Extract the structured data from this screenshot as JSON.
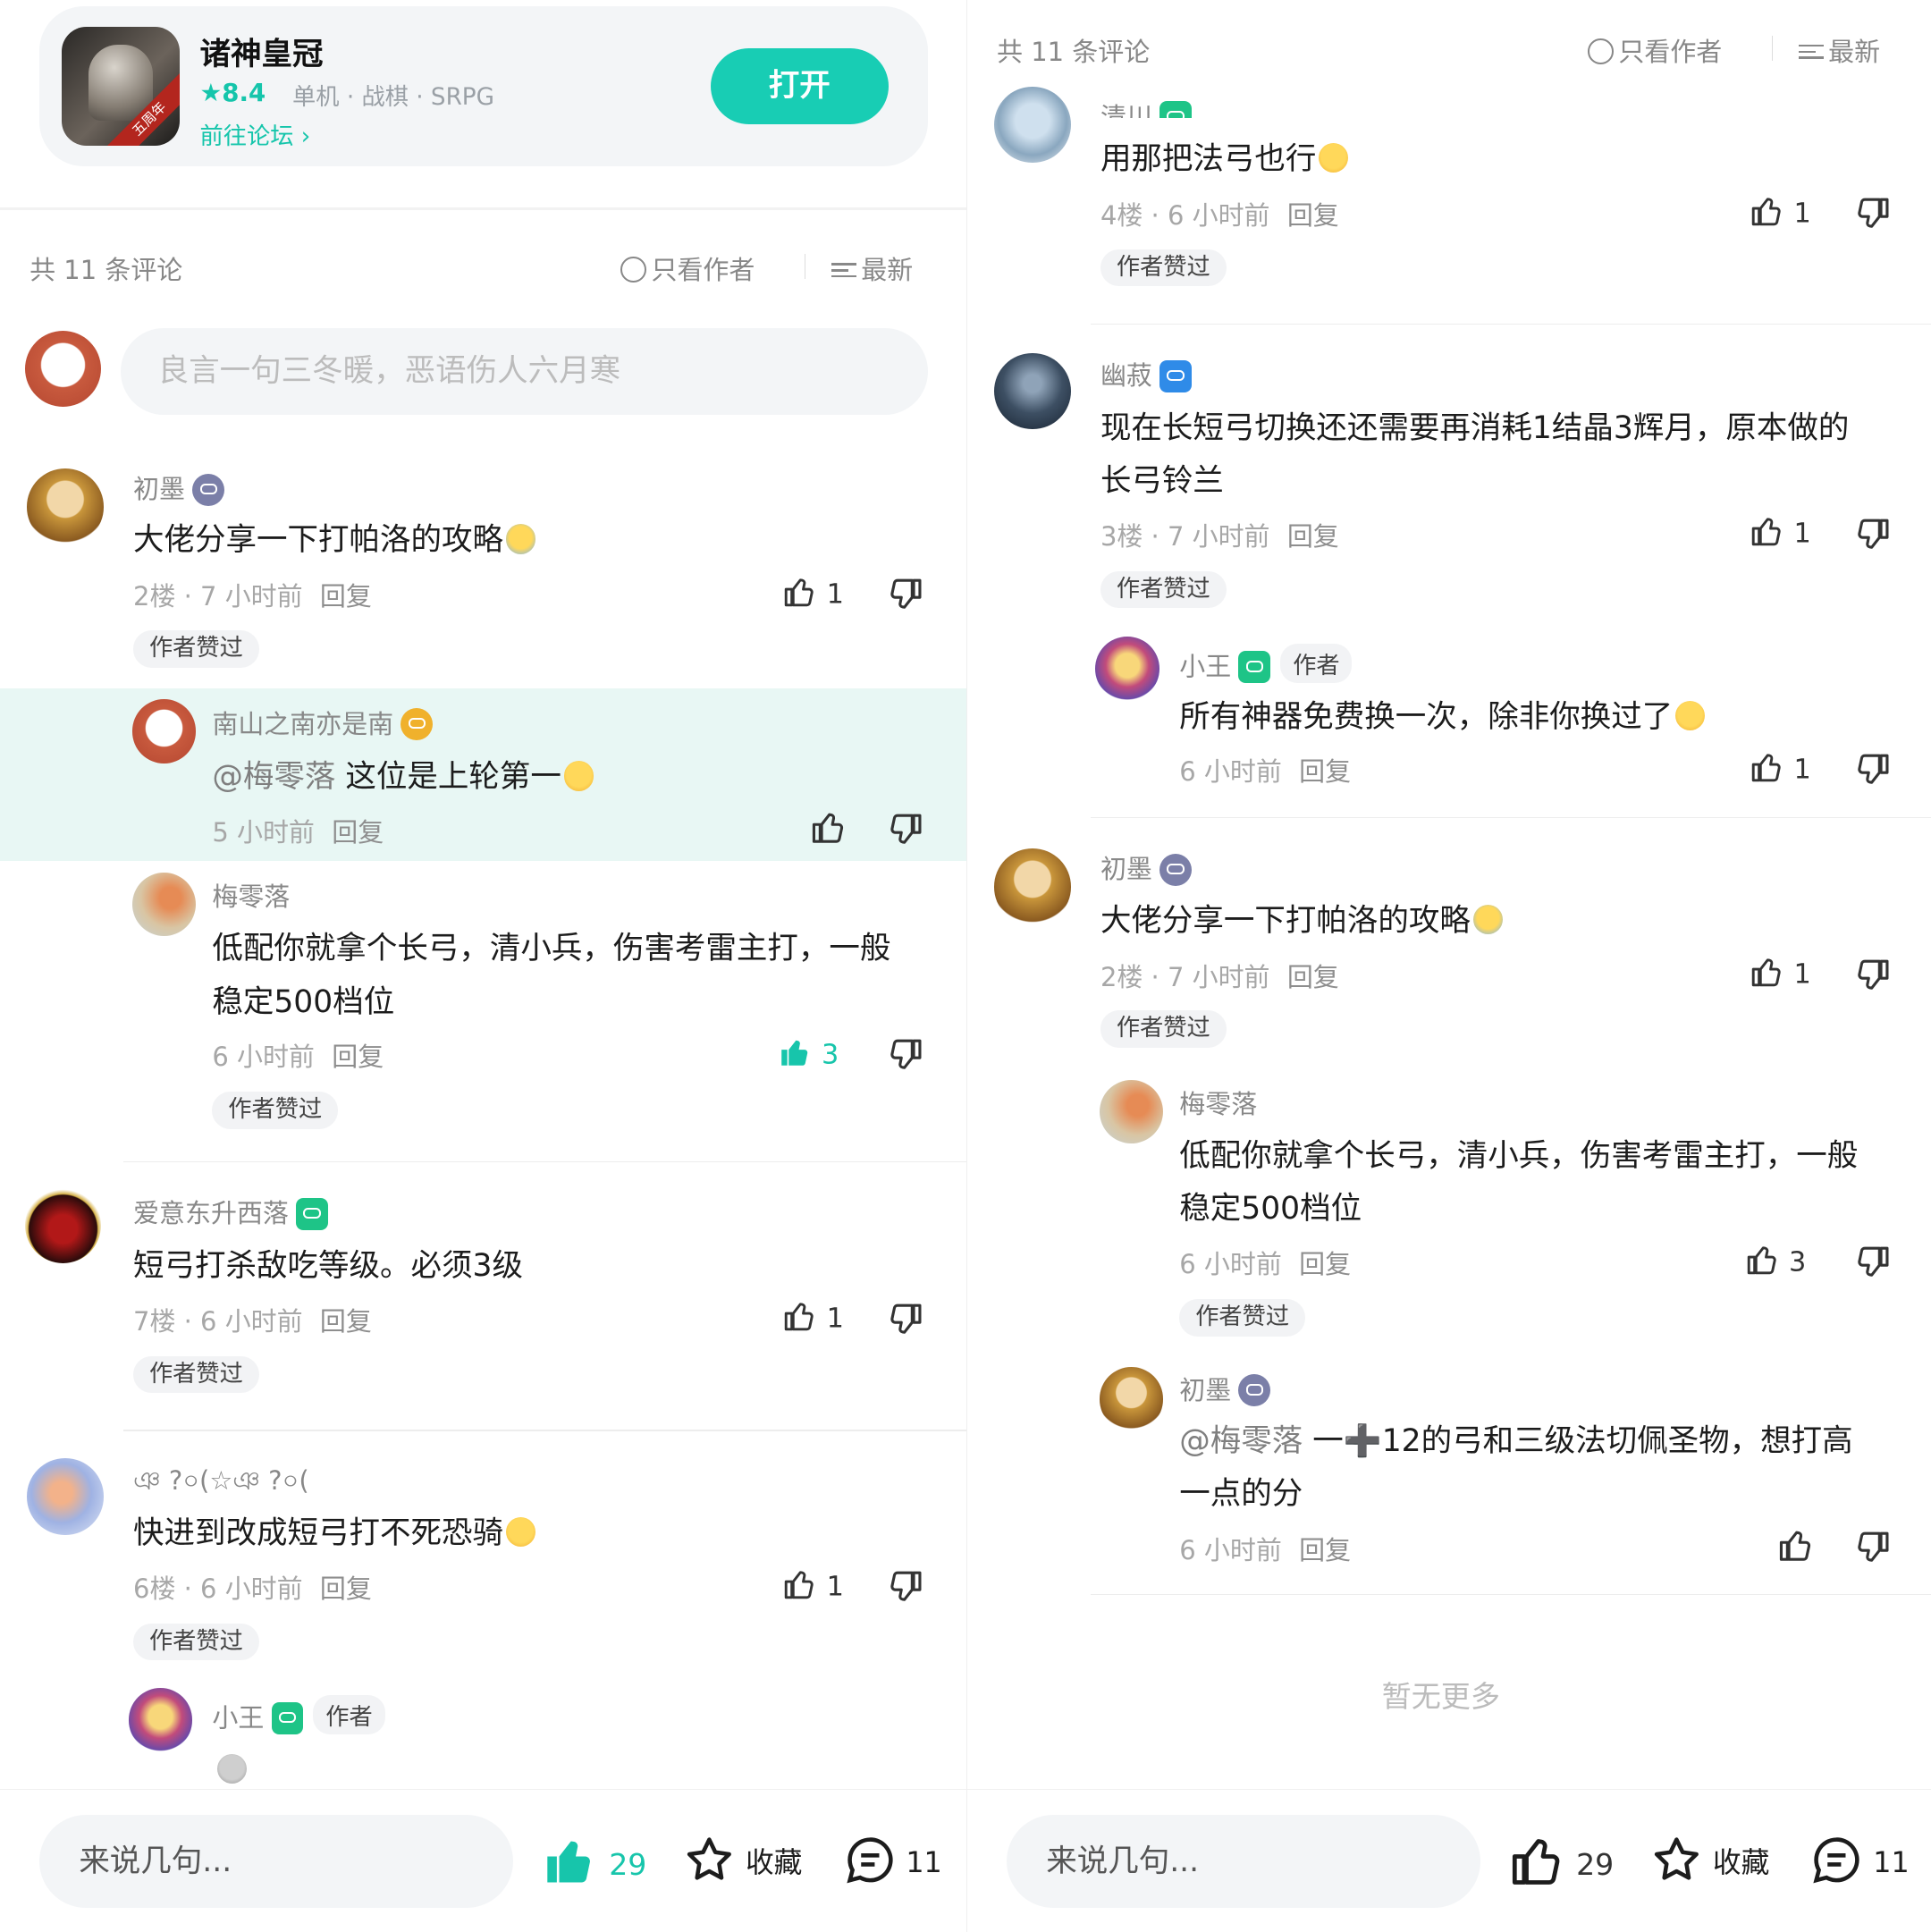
{
  "app": {
    "name": "诸神皇冠",
    "rating": "★8.4",
    "tags": "单机 · 战棋 · SRPG",
    "forum_link": "前往论坛 ›",
    "open_button": "打开",
    "icon_ribbon": "五周年"
  },
  "header": {
    "count": "共 11 条评论",
    "author_only": "只看作者",
    "sort": "最新"
  },
  "compose_placeholder": "良言一句三冬暖，恶语伤人六月寒",
  "left": {
    "c1": {
      "name": "初墨",
      "text": "大佬分享一下打帕洛的攻略",
      "meta": "2楼 · 7 小时前",
      "reply": "回复",
      "likes": "1",
      "tag": "作者赞过"
    },
    "r1": {
      "name": "南山之南亦是南",
      "at": "@梅零落",
      "text": " 这位是上轮第一",
      "meta": "5 小时前",
      "reply": "回复"
    },
    "r2": {
      "name": "梅零落",
      "text": "低配你就拿个长弓，清小兵，伤害考雷主打，一般稳定500档位",
      "meta": "6 小时前",
      "reply": "回复",
      "likes": "3",
      "tag": "作者赞过"
    },
    "c2": {
      "name": "爱意东升西落",
      "text": "短弓打杀敌吃等级。必须3级",
      "meta": "7楼 · 6 小时前",
      "reply": "回复",
      "likes": "1",
      "tag": "作者赞过"
    },
    "c3": {
      "name": "ঞ ?০(☆ঞ ?০(",
      "text": "快进到改成短弓打不死恐骑",
      "meta": "6楼 · 6 小时前",
      "reply": "回复",
      "likes": "1",
      "tag": "作者赞过"
    },
    "r3": {
      "name": "小王",
      "author_tag": "作者"
    }
  },
  "right": {
    "c1": {
      "name": "清川",
      "text": "用那把法弓也行",
      "meta": "4楼 · 6 小时前",
      "reply": "回复",
      "likes": "1",
      "tag": "作者赞过"
    },
    "c2": {
      "name": "幽菽",
      "text": "现在长短弓切换还还需要再消耗1结晶3辉月，原本做的长弓铃兰",
      "meta": "3楼 · 7 小时前",
      "reply": "回复",
      "likes": "1",
      "tag": "作者赞过"
    },
    "r1": {
      "name": "小王",
      "author_tag": "作者",
      "text": "所有神器免费换一次，除非你换过了",
      "meta": "6 小时前",
      "reply": "回复",
      "likes": "1"
    },
    "c3": {
      "name": "初墨",
      "text": "大佬分享一下打帕洛的攻略",
      "meta": "2楼 · 7 小时前",
      "reply": "回复",
      "likes": "1",
      "tag": "作者赞过"
    },
    "r2": {
      "name": "梅零落",
      "text": "低配你就拿个长弓，清小兵，伤害考雷主打，一般稳定500档位",
      "meta": "6 小时前",
      "reply": "回复",
      "likes": "3",
      "tag": "作者赞过"
    },
    "r3": {
      "name": "初墨",
      "at": "@梅零落",
      "text": " 一➕12的弓和三级法切佩圣物，想打高一点的分",
      "meta": "6 小时前",
      "reply": "回复"
    },
    "no_more": "暂无更多"
  },
  "bottom": {
    "say": "来说几句...",
    "likes": "29",
    "favorite": "收藏",
    "comments": "11"
  },
  "colors": {
    "accent": "#17c5ab",
    "highlight": "#e8f7f4"
  }
}
